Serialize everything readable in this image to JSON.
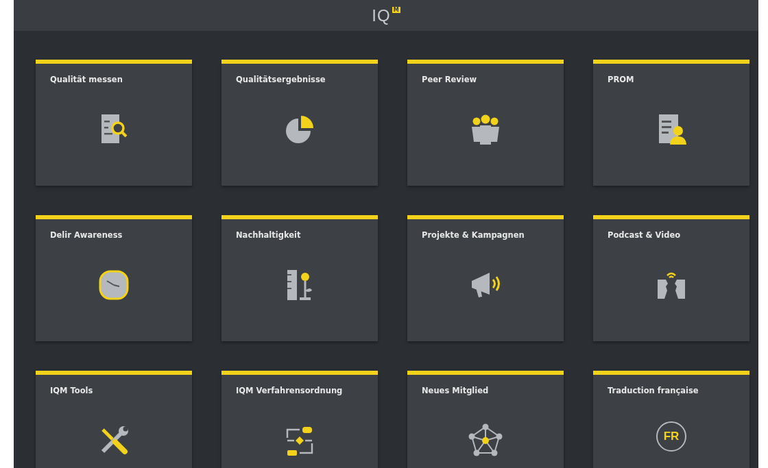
{
  "header": {
    "logo": "IQ",
    "logo_mark": "M"
  },
  "tiles": [
    {
      "title": "Qualität messen"
    },
    {
      "title": "Qualitätsergebnisse"
    },
    {
      "title": "Peer Review"
    },
    {
      "title": "PROM"
    },
    {
      "title": "Delir Awareness"
    },
    {
      "title": "Nachhaltigkeit"
    },
    {
      "title": "Projekte & Kampagnen"
    },
    {
      "title": "Podcast & Video"
    },
    {
      "title": "IQM Tools"
    },
    {
      "title": "IQM Verfahrensordnung"
    },
    {
      "title": "Neues Mitglied"
    },
    {
      "title": "Traduction française",
      "badge": "FR"
    }
  ]
}
